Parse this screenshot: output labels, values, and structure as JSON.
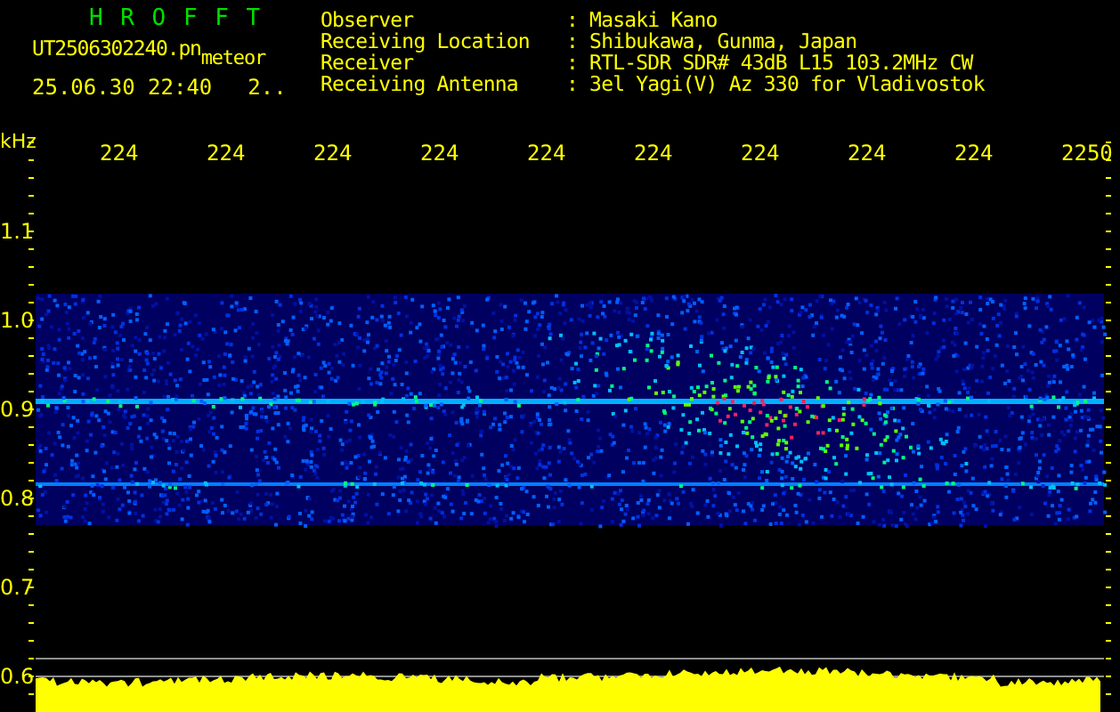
{
  "header": {
    "title": "H R O F F T",
    "filename": "UT2506302240.pn",
    "tag": "meteor",
    "datetime": "25.06.30 22:40",
    "field_4": "2..",
    "info": [
      {
        "label": "Observer",
        "value": ": Masaki Kano"
      },
      {
        "label": "Receiving Location",
        "value": ": Shibukawa, Gunma, Japan"
      },
      {
        "label": "Receiver",
        "value": ": RTL-SDR SDR# 43dB L15 103.2MHz CW"
      },
      {
        "label": "Receiving Antenna",
        "value": ": 3el Yagi(V) Az 330 for Vladivostok"
      }
    ]
  },
  "plot": {
    "unit": "kHz",
    "y_labels": [
      "1.1",
      "1.0",
      "0.9",
      "0.8",
      "0.7",
      "0.6"
    ],
    "x_labels": [
      "224",
      "224",
      "224",
      "224",
      "224",
      "224",
      "224",
      "224",
      "224",
      "2250"
    ]
  }
}
